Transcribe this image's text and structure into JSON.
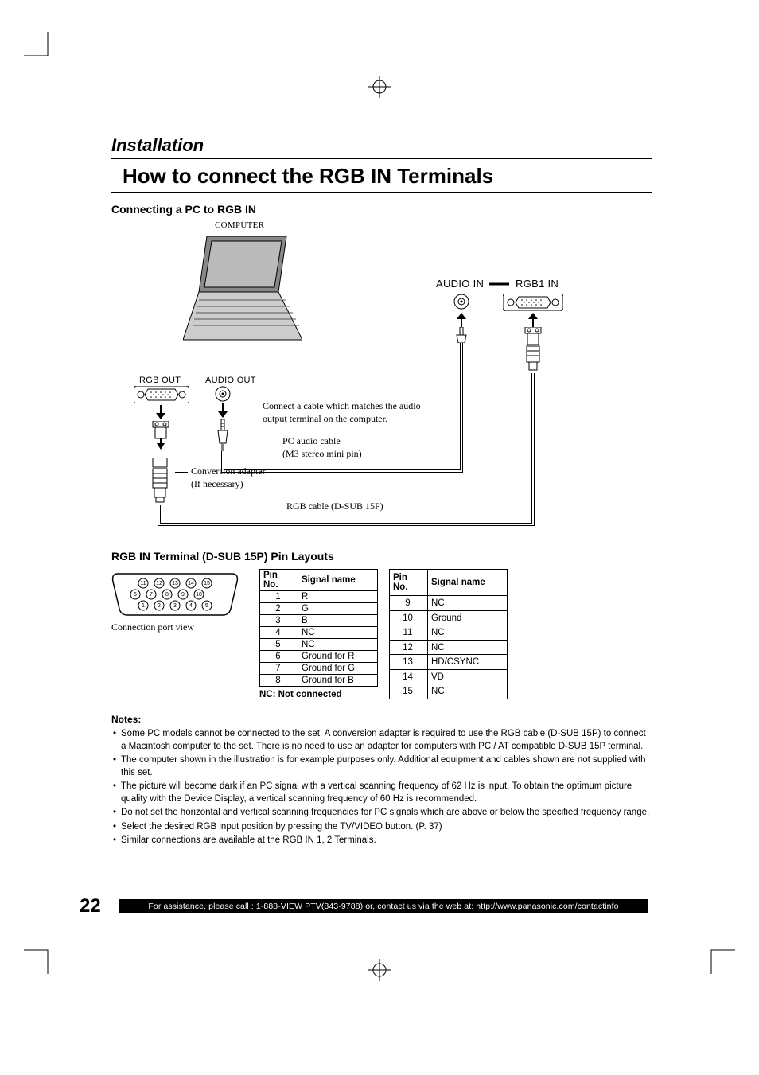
{
  "section_title": "Installation",
  "main_title": "How to connect the RGB IN Terminals",
  "subhead": "Connecting a PC to RGB IN",
  "diagram": {
    "computer_label": "COMPUTER",
    "rgb_out_label": "RGB OUT",
    "audio_out_label": "AUDIO OUT",
    "audio_in_label": "AUDIO IN",
    "rgb1_in_label": "RGB1 IN",
    "audio_hint_line1": "Connect a cable which matches the audio",
    "audio_hint_line2": "output terminal on the computer.",
    "pc_audio_line1": "PC audio cable",
    "pc_audio_line2": "(M3 stereo mini pin)",
    "conv_line1": "Conversion adapter",
    "conv_line2": "(If necessary)",
    "rgb_cable_label": "RGB cable (D-SUB 15P)"
  },
  "pinlayout_title": "RGB IN Terminal (D-SUB 15P) Pin Layouts",
  "port_caption": "Connection port view",
  "pin_header": {
    "pin": "Pin No.",
    "signal": "Signal name"
  },
  "pins_left": [
    {
      "pin": "1",
      "signal": "R"
    },
    {
      "pin": "2",
      "signal": "G"
    },
    {
      "pin": "3",
      "signal": "B"
    },
    {
      "pin": "4",
      "signal": "NC"
    },
    {
      "pin": "5",
      "signal": "NC"
    },
    {
      "pin": "6",
      "signal": "Ground for R"
    },
    {
      "pin": "7",
      "signal": "Ground for G"
    },
    {
      "pin": "8",
      "signal": "Ground for B"
    }
  ],
  "pins_right": [
    {
      "pin": "9",
      "signal": "NC"
    },
    {
      "pin": "10",
      "signal": "Ground"
    },
    {
      "pin": "11",
      "signal": "NC"
    },
    {
      "pin": "12",
      "signal": "NC"
    },
    {
      "pin": "13",
      "signal": "HD/CSYNC"
    },
    {
      "pin": "14",
      "signal": "VD"
    },
    {
      "pin": "15",
      "signal": "NC"
    }
  ],
  "nc_note": "NC: Not connected",
  "notes_head": "Notes:",
  "notes": [
    "Some PC models cannot be connected to the set. A conversion adapter is required to use the RGB cable (D-SUB 15P) to connect a Macintosh computer to the set. There is no need to use an adapter for computers with PC / AT compatible D-SUB 15P terminal.",
    "The computer shown in the illustration is for example purposes only. Additional equipment and cables shown are not supplied with this set.",
    "The picture will become dark if an PC signal with a vertical scanning frequency of 62 Hz is input. To obtain the optimum picture quality with the Device Display, a vertical scanning frequency of 60 Hz is recommended.",
    "Do not set the horizontal and vertical scanning frequencies for PC signals which are above or below the specified frequency range.",
    "Select the desired RGB input position by pressing the TV/VIDEO button. (P. 37)",
    "Similar connections are available at the RGB IN 1, 2 Terminals."
  ],
  "page_number": "22",
  "assist_text": "For assistance, please call : 1-888-VIEW PTV(843-9788) or, contact us via the web at: http://www.panasonic.com/contactinfo"
}
